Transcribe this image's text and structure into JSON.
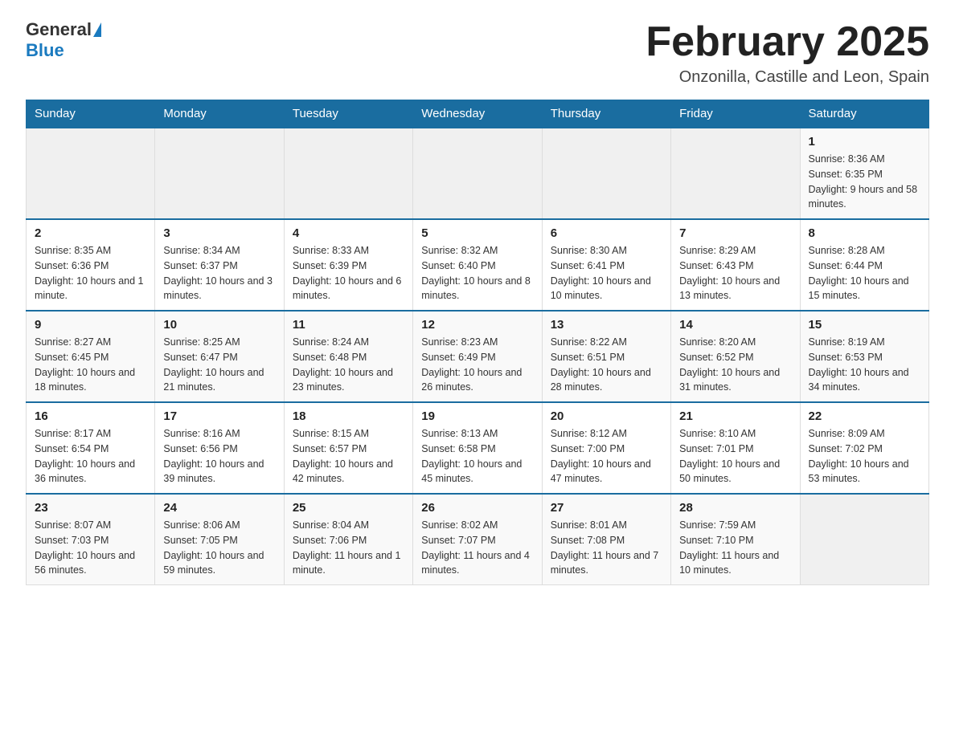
{
  "logo": {
    "general": "General",
    "blue": "Blue"
  },
  "title": "February 2025",
  "location": "Onzonilla, Castille and Leon, Spain",
  "weekdays": [
    "Sunday",
    "Monday",
    "Tuesday",
    "Wednesday",
    "Thursday",
    "Friday",
    "Saturday"
  ],
  "weeks": [
    [
      {
        "day": "",
        "info": ""
      },
      {
        "day": "",
        "info": ""
      },
      {
        "day": "",
        "info": ""
      },
      {
        "day": "",
        "info": ""
      },
      {
        "day": "",
        "info": ""
      },
      {
        "day": "",
        "info": ""
      },
      {
        "day": "1",
        "info": "Sunrise: 8:36 AM\nSunset: 6:35 PM\nDaylight: 9 hours and 58 minutes."
      }
    ],
    [
      {
        "day": "2",
        "info": "Sunrise: 8:35 AM\nSunset: 6:36 PM\nDaylight: 10 hours and 1 minute."
      },
      {
        "day": "3",
        "info": "Sunrise: 8:34 AM\nSunset: 6:37 PM\nDaylight: 10 hours and 3 minutes."
      },
      {
        "day": "4",
        "info": "Sunrise: 8:33 AM\nSunset: 6:39 PM\nDaylight: 10 hours and 6 minutes."
      },
      {
        "day": "5",
        "info": "Sunrise: 8:32 AM\nSunset: 6:40 PM\nDaylight: 10 hours and 8 minutes."
      },
      {
        "day": "6",
        "info": "Sunrise: 8:30 AM\nSunset: 6:41 PM\nDaylight: 10 hours and 10 minutes."
      },
      {
        "day": "7",
        "info": "Sunrise: 8:29 AM\nSunset: 6:43 PM\nDaylight: 10 hours and 13 minutes."
      },
      {
        "day": "8",
        "info": "Sunrise: 8:28 AM\nSunset: 6:44 PM\nDaylight: 10 hours and 15 minutes."
      }
    ],
    [
      {
        "day": "9",
        "info": "Sunrise: 8:27 AM\nSunset: 6:45 PM\nDaylight: 10 hours and 18 minutes."
      },
      {
        "day": "10",
        "info": "Sunrise: 8:25 AM\nSunset: 6:47 PM\nDaylight: 10 hours and 21 minutes."
      },
      {
        "day": "11",
        "info": "Sunrise: 8:24 AM\nSunset: 6:48 PM\nDaylight: 10 hours and 23 minutes."
      },
      {
        "day": "12",
        "info": "Sunrise: 8:23 AM\nSunset: 6:49 PM\nDaylight: 10 hours and 26 minutes."
      },
      {
        "day": "13",
        "info": "Sunrise: 8:22 AM\nSunset: 6:51 PM\nDaylight: 10 hours and 28 minutes."
      },
      {
        "day": "14",
        "info": "Sunrise: 8:20 AM\nSunset: 6:52 PM\nDaylight: 10 hours and 31 minutes."
      },
      {
        "day": "15",
        "info": "Sunrise: 8:19 AM\nSunset: 6:53 PM\nDaylight: 10 hours and 34 minutes."
      }
    ],
    [
      {
        "day": "16",
        "info": "Sunrise: 8:17 AM\nSunset: 6:54 PM\nDaylight: 10 hours and 36 minutes."
      },
      {
        "day": "17",
        "info": "Sunrise: 8:16 AM\nSunset: 6:56 PM\nDaylight: 10 hours and 39 minutes."
      },
      {
        "day": "18",
        "info": "Sunrise: 8:15 AM\nSunset: 6:57 PM\nDaylight: 10 hours and 42 minutes."
      },
      {
        "day": "19",
        "info": "Sunrise: 8:13 AM\nSunset: 6:58 PM\nDaylight: 10 hours and 45 minutes."
      },
      {
        "day": "20",
        "info": "Sunrise: 8:12 AM\nSunset: 7:00 PM\nDaylight: 10 hours and 47 minutes."
      },
      {
        "day": "21",
        "info": "Sunrise: 8:10 AM\nSunset: 7:01 PM\nDaylight: 10 hours and 50 minutes."
      },
      {
        "day": "22",
        "info": "Sunrise: 8:09 AM\nSunset: 7:02 PM\nDaylight: 10 hours and 53 minutes."
      }
    ],
    [
      {
        "day": "23",
        "info": "Sunrise: 8:07 AM\nSunset: 7:03 PM\nDaylight: 10 hours and 56 minutes."
      },
      {
        "day": "24",
        "info": "Sunrise: 8:06 AM\nSunset: 7:05 PM\nDaylight: 10 hours and 59 minutes."
      },
      {
        "day": "25",
        "info": "Sunrise: 8:04 AM\nSunset: 7:06 PM\nDaylight: 11 hours and 1 minute."
      },
      {
        "day": "26",
        "info": "Sunrise: 8:02 AM\nSunset: 7:07 PM\nDaylight: 11 hours and 4 minutes."
      },
      {
        "day": "27",
        "info": "Sunrise: 8:01 AM\nSunset: 7:08 PM\nDaylight: 11 hours and 7 minutes."
      },
      {
        "day": "28",
        "info": "Sunrise: 7:59 AM\nSunset: 7:10 PM\nDaylight: 11 hours and 10 minutes."
      },
      {
        "day": "",
        "info": ""
      }
    ]
  ]
}
